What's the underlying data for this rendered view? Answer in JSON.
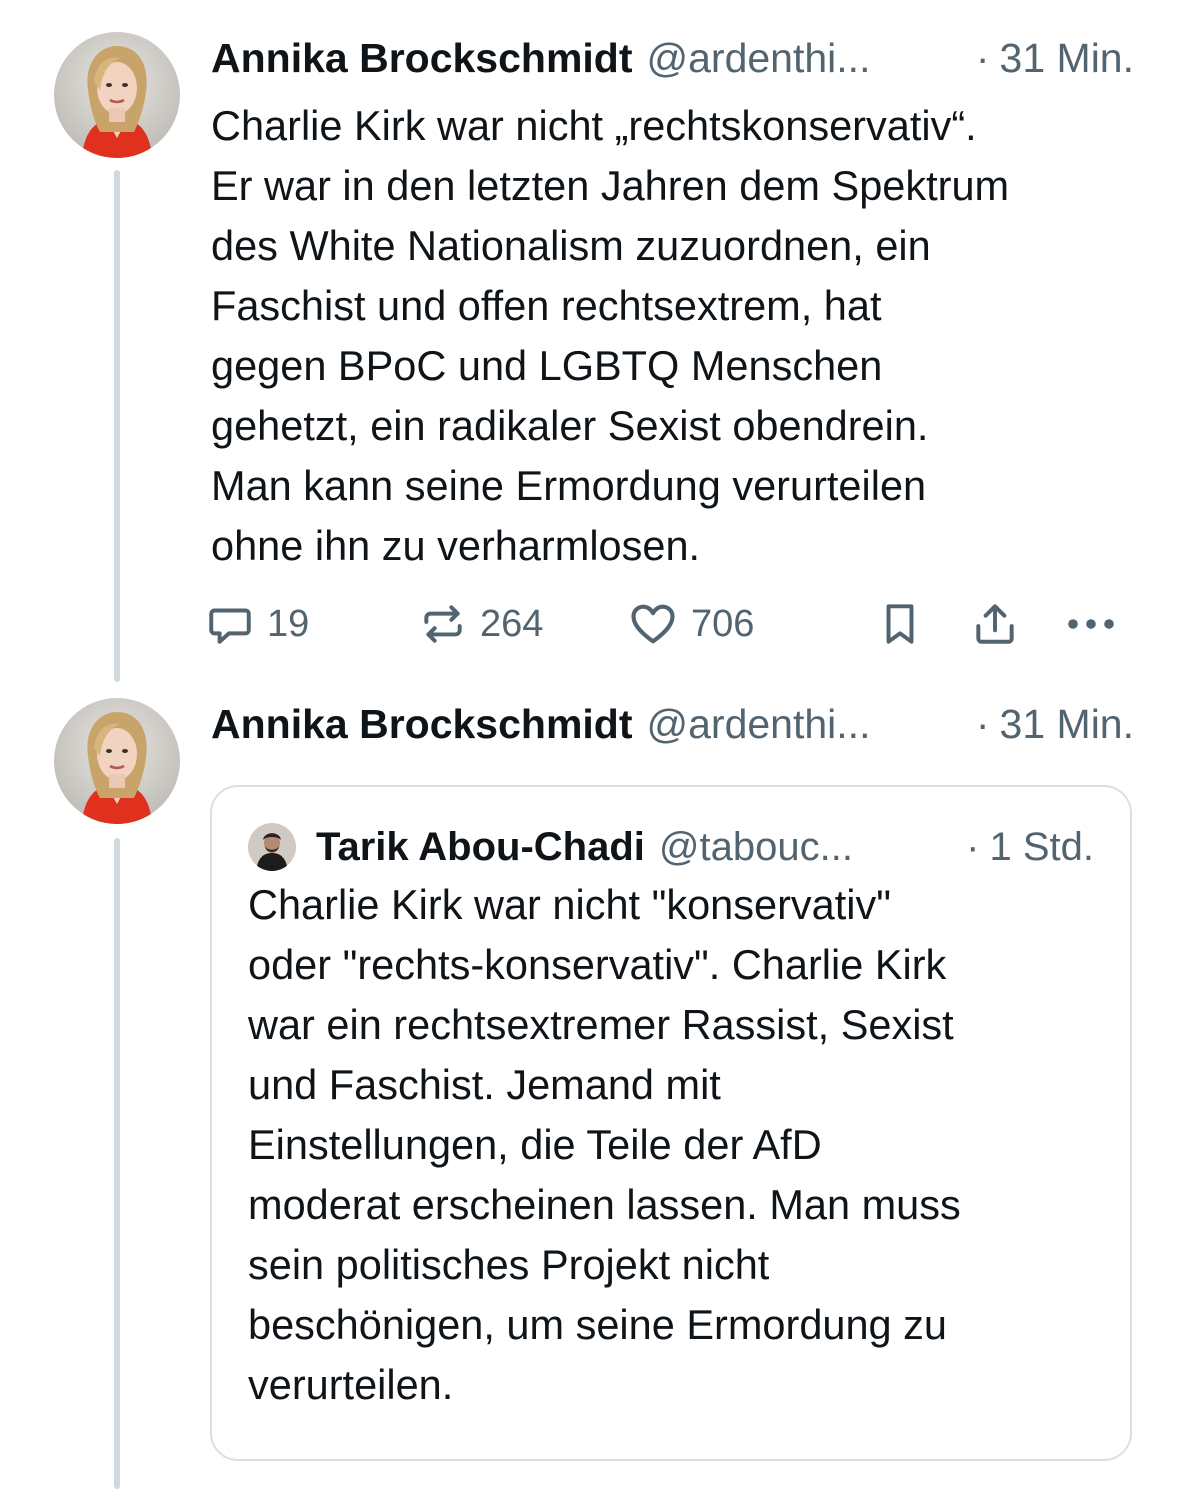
{
  "thread": {
    "post1": {
      "author_name": "Annika Brockschmidt",
      "handle": "@ardenthi...",
      "separator": "·",
      "time": "31 Min.",
      "text": "Charlie Kirk war nicht „rechtskonservativ“.\nEr war in den letzten Jahren dem Spektrum\ndes White Nationalism zuzuordnen, ein\nFaschist und offen rechtsextrem, hat\ngegen BPoC und LGBTQ Menschen\ngehetzt, ein radikaler Sexist obendrein.\nMan kann seine Ermordung verurteilen\nohne ihn zu verharmlosen.",
      "actions": {
        "reply_icon": "reply-icon",
        "reply_count": "19",
        "repost_icon": "repost-icon",
        "repost_count": "264",
        "like_icon": "heart-icon",
        "like_count": "706",
        "bookmark_icon": "bookmark-icon",
        "share_icon": "share-icon",
        "more_icon": "more-icon"
      }
    },
    "post2": {
      "author_name": "Annika Brockschmidt",
      "handle": "@ardenthi...",
      "separator": "·",
      "time": "31 Min.",
      "quote": {
        "author_name": "Tarik Abou-Chadi",
        "handle": "@tabouc...",
        "separator": "·",
        "time": "1 Std.",
        "text": "Charlie Kirk war nicht \"konservativ\"\noder \"rechts-konservativ\". Charlie Kirk\nwar ein rechtsextremer Rassist, Sexist\nund Faschist. Jemand mit\nEinstellungen, die Teile der AfD\nmoderat erscheinen lassen. Man muss\nsein politisches Projekt nicht\nbeschönigen, um seine Ermordung zu\nverurteilen."
      }
    }
  },
  "colors": {
    "text_primary": "#0f1419",
    "text_secondary": "#536471",
    "thread_line": "#cfd9de",
    "card_border": "#d9dfe3",
    "avatar_jacket": "#e0301e"
  }
}
